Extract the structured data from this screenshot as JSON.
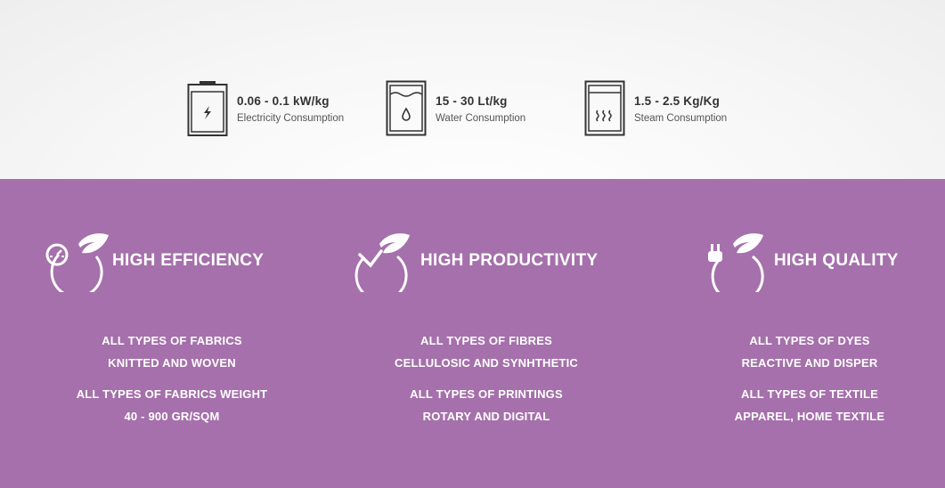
{
  "stats": [
    {
      "value": "0.06 - 0.1 kW/kg",
      "label": "Electricity Consumption",
      "icon": "battery-bolt-icon"
    },
    {
      "value": "15 - 30 Lt/kg",
      "label": "Water Consumption",
      "icon": "water-tank-icon"
    },
    {
      "value": "1.5 - 2.5 Kg/Kg",
      "label": "Steam Consumption",
      "icon": "steam-tank-icon"
    }
  ],
  "features": [
    {
      "title": "HIGH EFFICIENCY",
      "icon": "gauge-leaf-icon",
      "lines": [
        "ALL TYPES OF FABRICS",
        "KNITTED AND WOVEN",
        "ALL TYPES OF FABRICS WEIGHT",
        "40 - 900 GR/SQM"
      ]
    },
    {
      "title": "HIGH PRODUCTIVITY",
      "icon": "check-leaf-icon",
      "lines": [
        "ALL TYPES OF FIBRES",
        "CELLULOSIC AND SYNHTHETIC",
        "ALL TYPES OF PRINTINGS",
        "ROTARY AND DIGITAL"
      ]
    },
    {
      "title": "HIGH QUALITY",
      "icon": "plug-leaf-icon",
      "lines": [
        "ALL TYPES OF DYES",
        "REACTIVE AND DISPER",
        "ALL TYPES OF TEXTILE",
        "APPAREL, HOME TEXTILE"
      ]
    }
  ],
  "colors": {
    "purple": "#a570ab",
    "dark": "#333333"
  }
}
